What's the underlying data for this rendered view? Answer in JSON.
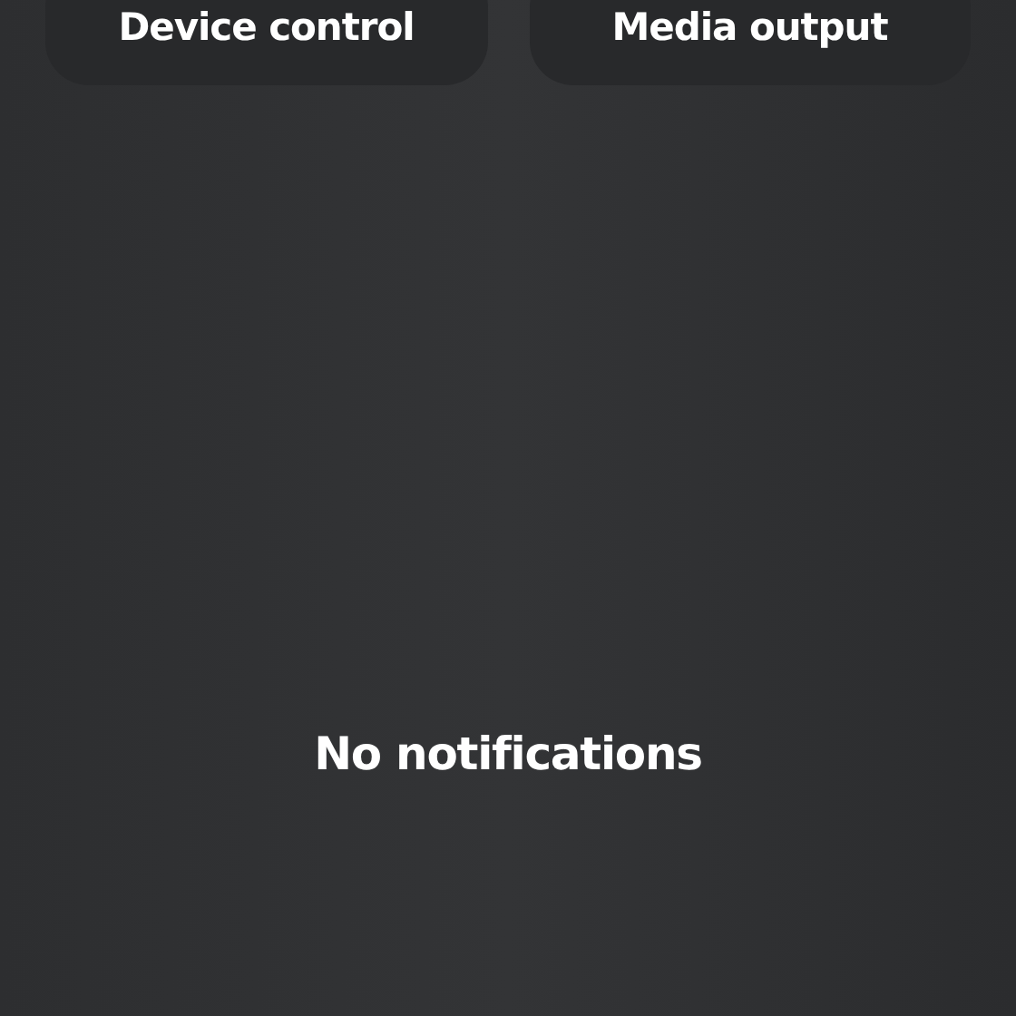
{
  "quick_buttons": [
    {
      "label": "Device control"
    },
    {
      "label": "Media output"
    }
  ],
  "empty_message": "No notifications"
}
